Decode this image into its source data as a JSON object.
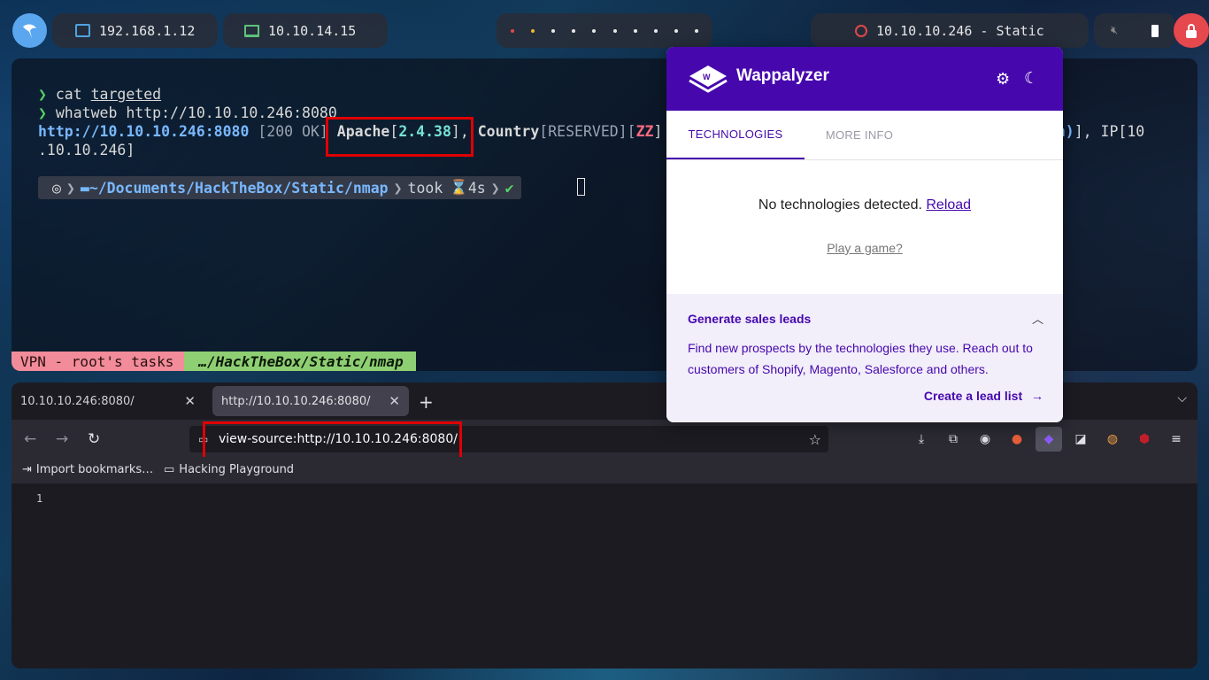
{
  "topbar": {
    "local_ip": "192.168.1.12",
    "vpn_ip": "10.10.14.15",
    "target": "10.10.10.246 - Static"
  },
  "terminal": {
    "cmd1_prompt": "❯",
    "cmd1": "cat",
    "cmd1_arg": "targeted",
    "cmd2_prompt": "❯",
    "cmd2": "whatweb http://10.10.10.246:8080",
    "out_url": "http://10.10.10.246:8080",
    "out_status": " [200 OK] ",
    "out_apache": "Apache",
    "out_apache_ver": "2.4.38",
    "out_country": "Country",
    "out_country_val": "[RESERVED][",
    "out_country_code": "ZZ",
    "out_tail": "ian)",
    "out_ip": "], IP[10",
    "out_wrap": ".10.10.246]",
    "prompt_path": "~/Documents/HackTheBox/Static/nmap",
    "prompt_took": "took",
    "prompt_time": "4s",
    "status_vpn": "VPN - root's tasks",
    "status_path": "…/HackTheBox/Static/nmap"
  },
  "browser": {
    "tab1": "10.10.10.246:8080/",
    "tab2": "http://10.10.10.246:8080/",
    "url": "view-source:http://10.10.10.246:8080/",
    "bookmark1": "Import bookmarks…",
    "bookmark2": "Hacking Playground",
    "line_no": "1"
  },
  "wappalyzer": {
    "brand": "Wappalyzer",
    "tab_technologies": "TECHNOLOGIES",
    "tab_more_info": "MORE INFO",
    "no_tech": "No technologies detected.",
    "reload": "Reload",
    "game": "Play a game?",
    "leads_title": "Generate sales leads",
    "leads_text": "Find new prospects by the technologies they use. Reach out to customers of Shopify, Magento, Salesforce and others.",
    "leads_cta": "Create a lead list"
  },
  "colors": {
    "wappalyzer_purple": "#4608ad",
    "highlight_red": "#e00000",
    "lock_red": "#e5484d"
  }
}
